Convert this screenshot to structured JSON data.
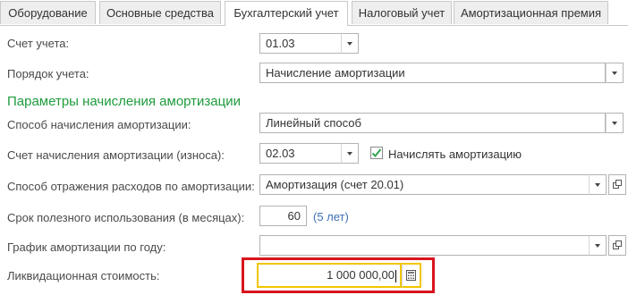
{
  "tabs": [
    {
      "label": "Оборудование"
    },
    {
      "label": "Основные средства"
    },
    {
      "label": "Бухгалтерский учет"
    },
    {
      "label": "Налоговый учет"
    },
    {
      "label": "Амортизационная премия"
    }
  ],
  "active_tab": "Бухгалтерский учет",
  "account": {
    "label": "Счет учета:",
    "value": "01.03"
  },
  "accounting_order": {
    "label": "Порядок учета:",
    "value": "Начисление амортизации"
  },
  "section_title": "Параметры начисления амортизации",
  "method": {
    "label": "Способ начисления амортизации:",
    "value": "Линейный способ"
  },
  "depr_account": {
    "label": "Счет начисления амортизации (износа):",
    "value": "02.03"
  },
  "accrue_checkbox": {
    "label": "Начислять амортизацию",
    "checked": true
  },
  "expense_method": {
    "label": "Способ отражения расходов по амортизации:",
    "value": "Амортизация (счет 20.01)"
  },
  "useful_life": {
    "label": "Срок полезного использования (в месяцах):",
    "value": "60",
    "hint": "(5 лет)"
  },
  "schedule": {
    "label": "График амортизации по году:",
    "value": ""
  },
  "liquidation": {
    "label": "Ликвидационная стоимость:",
    "value": "1 000 000,00"
  },
  "colors": {
    "section_title": "#1e9b3c",
    "hint": "#3d6fb6",
    "highlight": "#d8141e",
    "focus": "#f0c600"
  }
}
